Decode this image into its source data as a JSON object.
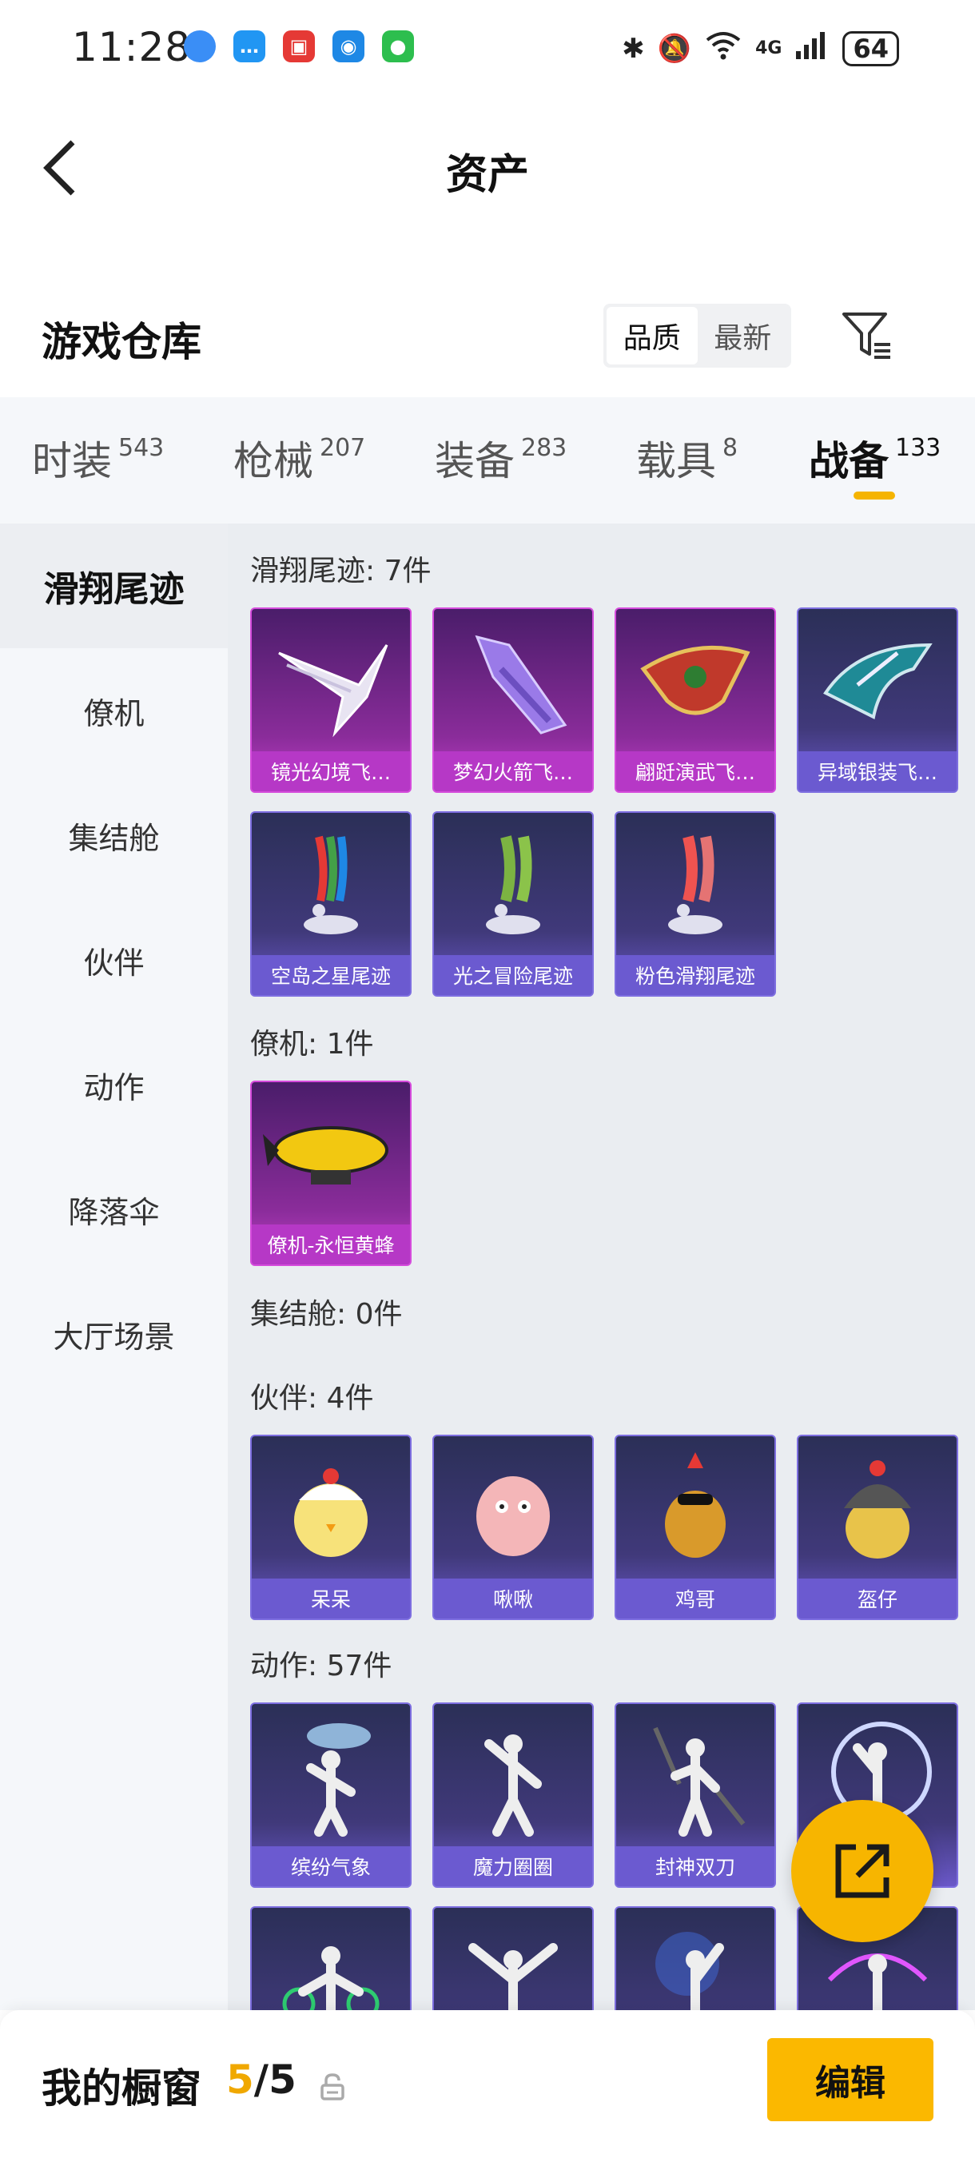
{
  "status_bar": {
    "time": "11:28",
    "battery": "64",
    "network": "4G",
    "wifi_tag": "6"
  },
  "header": {
    "title": "资产"
  },
  "warehouse": {
    "title": "游戏仓库",
    "sort_quality": "品质",
    "sort_newest": "最新"
  },
  "tabs": [
    {
      "label": "时装",
      "count": "543"
    },
    {
      "label": "枪械",
      "count": "207"
    },
    {
      "label": "装备",
      "count": "283"
    },
    {
      "label": "载具",
      "count": "8"
    },
    {
      "label": "战备",
      "count": "133",
      "active": true
    }
  ],
  "subnav": [
    "滑翔尾迹",
    "僚机",
    "集结舱",
    "伙伴",
    "动作",
    "降落伞",
    "大厅场景"
  ],
  "groups": {
    "glide": {
      "title": "滑翔尾迹: 7件",
      "items": [
        "镜光幻境飞…",
        "梦幻火箭飞…",
        "翩跹演武飞…",
        "异域银装飞…",
        "空岛之星尾迹",
        "光之冒险尾迹",
        "粉色滑翔尾迹"
      ]
    },
    "wingman": {
      "title": "僚机: 1件",
      "items": [
        "僚机-永恒黄蜂"
      ]
    },
    "pod": {
      "title": "集结舱: 0件"
    },
    "companion": {
      "title": "伙伴: 4件",
      "items": [
        "呆呆",
        "啾啾",
        "鸡哥",
        "盔仔"
      ]
    },
    "emote": {
      "title": "动作: 57件",
      "items": [
        "缤纷气象",
        "魔力圈圈",
        "封神双刀"
      ]
    }
  },
  "bottom_bar": {
    "label": "我的橱窗",
    "count_current": "5",
    "count_sep": "/",
    "count_total": "5",
    "edit_label": "编辑"
  },
  "colors": {
    "accent": "#f7b500",
    "purple_quality": "#b638c6",
    "blue_quality": "#6b5ad0"
  }
}
